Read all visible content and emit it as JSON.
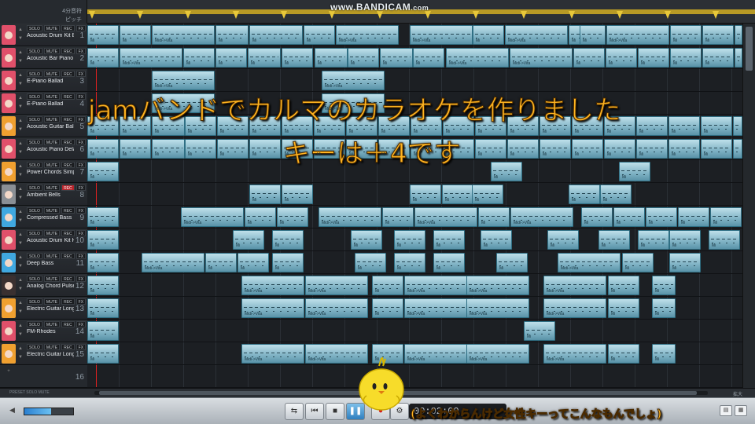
{
  "watermark": {
    "main": "www.BANDICAM",
    "suffix": ".com"
  },
  "ruler": {
    "label_top": "4分音符",
    "label_bottom": "ピッチ"
  },
  "tracks": [
    {
      "num": "1",
      "name": "Acoustic Drum Kit Br",
      "color": "#e0506a",
      "rec_active": false
    },
    {
      "num": "2",
      "name": "Acoustic Bar Piano",
      "color": "#e0506a",
      "rec_active": false
    },
    {
      "num": "3",
      "name": "E-Piano Ballad",
      "color": "#e0506a",
      "rec_active": false
    },
    {
      "num": "4",
      "name": "E-Piano Ballad",
      "color": "#e0506a",
      "rec_active": false
    },
    {
      "num": "5",
      "name": "Acoustic Guitar Balla",
      "color": "#f0a030",
      "rec_active": false
    },
    {
      "num": "6",
      "name": "Acoustic Piano Delay",
      "color": "#e0506a",
      "rec_active": false
    },
    {
      "num": "7",
      "name": "Power Chords Simple",
      "color": "#f0a030",
      "rec_active": false
    },
    {
      "num": "8",
      "name": "Ambient Bells",
      "color": "#8a8f95",
      "rec_active": true
    },
    {
      "num": "9",
      "name": "Compressed Bass",
      "color": "#40a8e0",
      "rec_active": false
    },
    {
      "num": "10",
      "name": "Acoustic Drum Kit Hi",
      "color": "#e0506a",
      "rec_active": false
    },
    {
      "num": "11",
      "name": "Deep Bass",
      "color": "#40a8e0",
      "rec_active": false
    },
    {
      "num": "12",
      "name": "Analog Chord Pulser (",
      "color": "#3a3030",
      "rec_active": false
    },
    {
      "num": "13",
      "name": "Electric Guitar Long (",
      "color": "#f0a030",
      "rec_active": false
    },
    {
      "num": "14",
      "name": "FM-Rhodes",
      "color": "#e0506a",
      "rec_active": false
    },
    {
      "num": "15",
      "name": "Electric Guitar Long (",
      "color": "#f0a030",
      "rec_active": false
    },
    {
      "num": "16",
      "name": "",
      "color": "",
      "rec_active": false
    }
  ],
  "track_buttons": {
    "solo": "SOLO",
    "mute": "MUTE",
    "rec": "REC",
    "fx": "FX"
  },
  "clip_label": "Midi->Vita",
  "clip_short_label": "Mi",
  "bottom_bar": {
    "labels": "PRESET   SOLO   MUTE",
    "zoom": "拡大"
  },
  "transport": {
    "time": "00:02:00"
  },
  "captions": {
    "line1": "jamバンドでカルマのカラオケを作りました",
    "line2": "キーは＋4です",
    "footnote": "(よくわからんけど女性キーってこんなもんでしょ)"
  }
}
